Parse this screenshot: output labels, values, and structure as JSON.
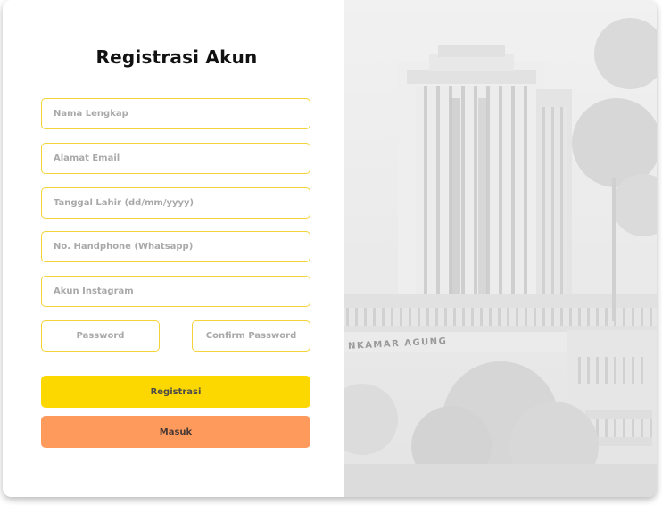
{
  "page": {
    "title": "Registrasi Akun"
  },
  "form": {
    "full_name": {
      "placeholder": "Nama Lengkap",
      "value": ""
    },
    "email": {
      "placeholder": "Alamat Email",
      "value": ""
    },
    "birth_date": {
      "placeholder": "Tanggal Lahir (dd/mm/yyyy)",
      "value": ""
    },
    "phone": {
      "placeholder": "No. Handphone (Whatsapp)",
      "value": ""
    },
    "instagram": {
      "placeholder": "Akun Instagram",
      "value": ""
    },
    "password": {
      "placeholder": "Password",
      "value": ""
    },
    "confirm_password": {
      "placeholder": "Confirm Password",
      "value": ""
    }
  },
  "buttons": {
    "register_label": "Registrasi",
    "login_label": "Masuk"
  },
  "colors": {
    "field_border": "#f4d33a",
    "register_bg": "#fcd800",
    "login_bg": "#fe9a5c"
  },
  "hero_image": {
    "description": "faded building photo",
    "sign_text": "NKAMAR AGUNG"
  }
}
